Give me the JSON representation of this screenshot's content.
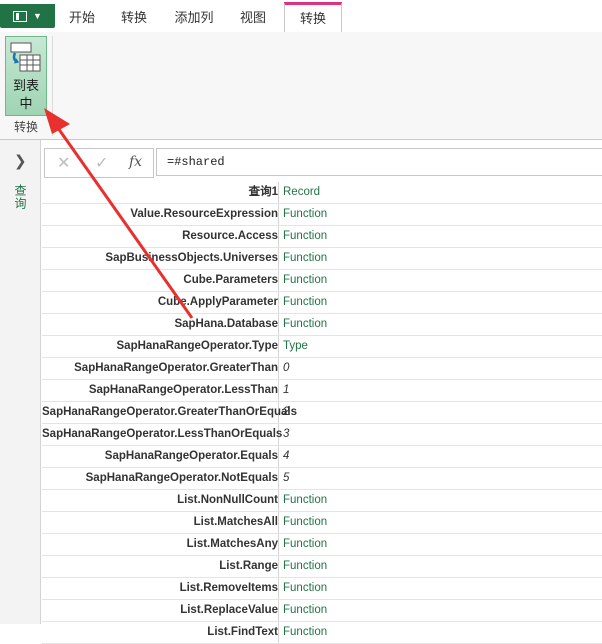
{
  "ribbon": {
    "tabs": [
      {
        "label": "开始"
      },
      {
        "label": "转换"
      },
      {
        "label": "添加列"
      },
      {
        "label": "视图"
      },
      {
        "label": "转换"
      }
    ],
    "to_table_label": "到表\n中",
    "group_label": "转换"
  },
  "left_pane": {
    "queries_label": "查询"
  },
  "formula_bar": {
    "cancel_glyph": "✕",
    "confirm_glyph": "✓",
    "fx_glyph": "fx",
    "formula": "=#shared"
  },
  "record": {
    "rows": [
      {
        "key": "查询1",
        "value": "Record",
        "kind": "text"
      },
      {
        "key": "Value.ResourceExpression",
        "value": "Function",
        "kind": "text"
      },
      {
        "key": "Resource.Access",
        "value": "Function",
        "kind": "text"
      },
      {
        "key": "SapBusinessObjects.Universes",
        "value": "Function",
        "kind": "text"
      },
      {
        "key": "Cube.Parameters",
        "value": "Function",
        "kind": "text"
      },
      {
        "key": "Cube.ApplyParameter",
        "value": "Function",
        "kind": "text"
      },
      {
        "key": "SapHana.Database",
        "value": "Function",
        "kind": "text"
      },
      {
        "key": "SapHanaRangeOperator.Type",
        "value": "Type",
        "kind": "text"
      },
      {
        "key": "SapHanaRangeOperator.GreaterThan",
        "value": "0",
        "kind": "num"
      },
      {
        "key": "SapHanaRangeOperator.LessThan",
        "value": "1",
        "kind": "num"
      },
      {
        "key": "SapHanaRangeOperator.GreaterThanOrEquals",
        "value": "2",
        "kind": "num"
      },
      {
        "key": "SapHanaRangeOperator.LessThanOrEquals",
        "value": "3",
        "kind": "num"
      },
      {
        "key": "SapHanaRangeOperator.Equals",
        "value": "4",
        "kind": "num"
      },
      {
        "key": "SapHanaRangeOperator.NotEquals",
        "value": "5",
        "kind": "num"
      },
      {
        "key": "List.NonNullCount",
        "value": "Function",
        "kind": "text"
      },
      {
        "key": "List.MatchesAll",
        "value": "Function",
        "kind": "text"
      },
      {
        "key": "List.MatchesAny",
        "value": "Function",
        "kind": "text"
      },
      {
        "key": "List.Range",
        "value": "Function",
        "kind": "text"
      },
      {
        "key": "List.RemoveItems",
        "value": "Function",
        "kind": "text"
      },
      {
        "key": "List.ReplaceValue",
        "value": "Function",
        "kind": "text"
      },
      {
        "key": "List.FindText",
        "value": "Function",
        "kind": "text"
      }
    ]
  },
  "colors": {
    "accent_green": "#217346",
    "active_tab_accent": "#e0317f",
    "annotation_arrow": "#e8302e"
  },
  "icons": {
    "file_menu": "document-icon",
    "to_table": "to-table-icon",
    "expand": "chevron-right-icon"
  }
}
